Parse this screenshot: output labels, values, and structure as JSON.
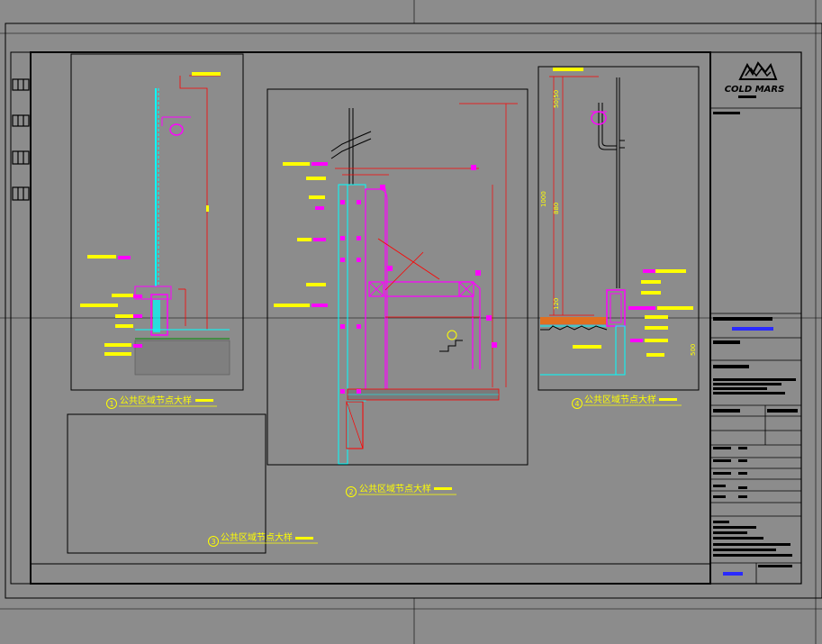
{
  "colors": {
    "background": "#8c8c8c",
    "frame": "#000000",
    "annotation": "#ffff00",
    "dimension": "#ff0000",
    "member": "#ff00ff",
    "glass": "#00ffff",
    "hatch": "#777777",
    "title_block_blue": "#2a2aff"
  },
  "details": [
    {
      "number": "1",
      "title": "公共区域节点大样"
    },
    {
      "number": "2",
      "title": "公共区域节点大样"
    },
    {
      "number": "3",
      "title": "公共区域节点大样"
    },
    {
      "number": "4",
      "title": "公共区域节点大样"
    }
  ],
  "dimensions": {
    "d4_top": "50|50",
    "d4_overall": "1000",
    "d4_mid": "880",
    "d4_low": "120",
    "d4_right": "500"
  },
  "title_block": {
    "logo_text": "COLD MARS",
    "logo_icon": "mountain-logo-icon"
  }
}
